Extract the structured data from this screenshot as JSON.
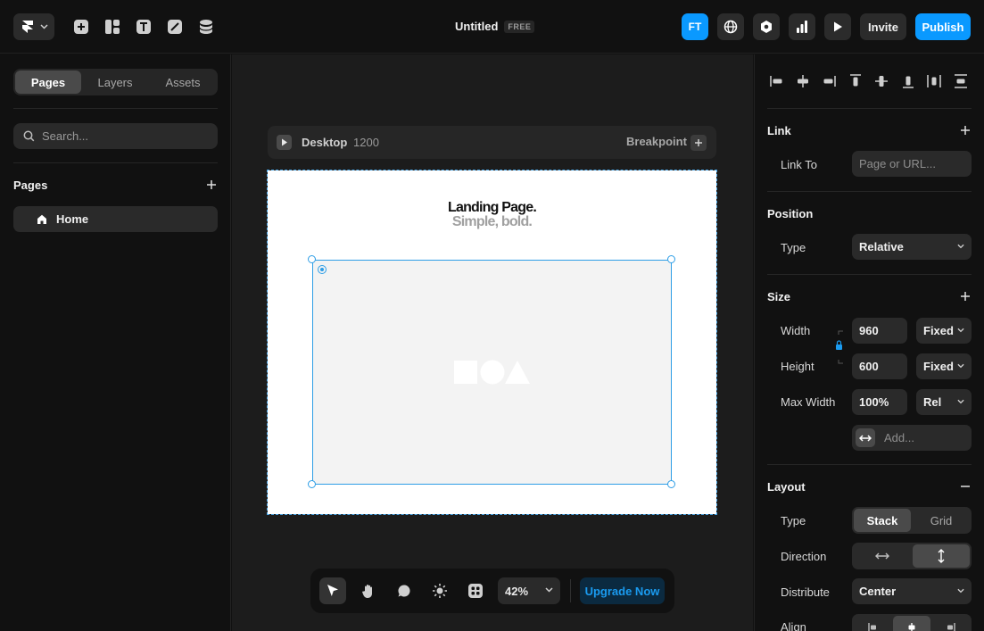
{
  "topbar": {
    "project_title": "Untitled",
    "plan_badge": "FREE",
    "avatar_initials": "FT",
    "invite_label": "Invite",
    "publish_label": "Publish"
  },
  "left": {
    "tabs": [
      "Pages",
      "Layers",
      "Assets"
    ],
    "search_placeholder": "Search...",
    "pages_title": "Pages",
    "pages": [
      "Home"
    ]
  },
  "canvas": {
    "breakpoint_device": "Desktop",
    "breakpoint_width": "1200",
    "breakpoint_label": "Breakpoint",
    "hero_title": "Landing Page.",
    "hero_subtitle": "Simple, bold.",
    "zoom": "42%",
    "upgrade_label": "Upgrade Now"
  },
  "right": {
    "link": {
      "title": "Link",
      "link_to_label": "Link To",
      "link_to_placeholder": "Page or URL..."
    },
    "position": {
      "title": "Position",
      "type_label": "Type",
      "type_value": "Relative"
    },
    "size": {
      "title": "Size",
      "width_label": "Width",
      "width_value": "960",
      "width_mode": "Fixed",
      "height_label": "Height",
      "height_value": "600",
      "height_mode": "Fixed",
      "maxwidth_label": "Max Width",
      "maxwidth_value": "100%",
      "maxwidth_mode": "Rel",
      "add_placeholder": "Add..."
    },
    "layout": {
      "title": "Layout",
      "type_label": "Type",
      "type_options": [
        "Stack",
        "Grid"
      ],
      "type_selected": "Stack",
      "direction_label": "Direction",
      "distribute_label": "Distribute",
      "distribute_value": "Center",
      "align_label": "Align"
    }
  },
  "colors": {
    "accent": "#0a99ff",
    "selection": "#2e9ee6",
    "panel_bg": "#111111",
    "canvas_bg": "#1c1c1c"
  }
}
